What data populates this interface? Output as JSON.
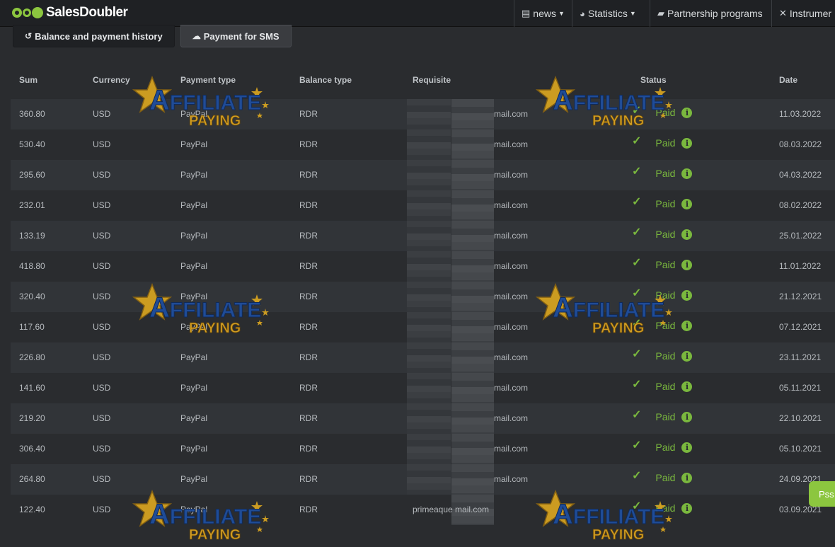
{
  "brand": {
    "name": "SalesDoubler"
  },
  "nav": [
    {
      "label": "news",
      "icon": "newspaper-icon",
      "dropdown": true
    },
    {
      "label": "Statistics",
      "icon": "pie-chart-icon",
      "dropdown": true
    },
    {
      "label": "Partnership programs",
      "icon": "briefcase-icon",
      "dropdown": false
    },
    {
      "label": "Instrumer",
      "icon": "tools-icon",
      "dropdown": false
    }
  ],
  "tabs": [
    {
      "label": "Balance and payment history",
      "icon": "history-icon",
      "active": true
    },
    {
      "label": "Payment for SMS",
      "icon": "chat-icon",
      "active": false
    }
  ],
  "table": {
    "headers": [
      "Sum",
      "Currency",
      "Payment type",
      "Balance type",
      "Requisite",
      "Status",
      "Date"
    ],
    "rows": [
      {
        "sum": "360.80",
        "currency": "USD",
        "payment_type": "PayPal",
        "balance_type": "RDR",
        "requisite": "mail.com",
        "status": "Paid",
        "date": "11.03.2022"
      },
      {
        "sum": "530.40",
        "currency": "USD",
        "payment_type": "PayPal",
        "balance_type": "RDR",
        "requisite": "mail.com",
        "status": "Paid",
        "date": "08.03.2022"
      },
      {
        "sum": "295.60",
        "currency": "USD",
        "payment_type": "PayPal",
        "balance_type": "RDR",
        "requisite": "mail.com",
        "status": "Paid",
        "date": "04.03.2022"
      },
      {
        "sum": "232.01",
        "currency": "USD",
        "payment_type": "PayPal",
        "balance_type": "RDR",
        "requisite": "mail.com",
        "status": "Paid",
        "date": "08.02.2022"
      },
      {
        "sum": "133.19",
        "currency": "USD",
        "payment_type": "PayPal",
        "balance_type": "RDR",
        "requisite": "mail.com",
        "status": "Paid",
        "date": "25.01.2022"
      },
      {
        "sum": "418.80",
        "currency": "USD",
        "payment_type": "PayPal",
        "balance_type": "RDR",
        "requisite": "mail.com",
        "status": "Paid",
        "date": "11.01.2022"
      },
      {
        "sum": "320.40",
        "currency": "USD",
        "payment_type": "PayPal",
        "balance_type": "RDR",
        "requisite": "mail.com",
        "status": "Paid",
        "date": "21.12.2021"
      },
      {
        "sum": "117.60",
        "currency": "USD",
        "payment_type": "PayPal",
        "balance_type": "RDR",
        "requisite": "mail.com",
        "status": "Paid",
        "date": "07.12.2021"
      },
      {
        "sum": "226.80",
        "currency": "USD",
        "payment_type": "PayPal",
        "balance_type": "RDR",
        "requisite": "mail.com",
        "status": "Paid",
        "date": "23.11.2021"
      },
      {
        "sum": "141.60",
        "currency": "USD",
        "payment_type": "PayPal",
        "balance_type": "RDR",
        "requisite": "mail.com",
        "status": "Paid",
        "date": "05.11.2021"
      },
      {
        "sum": "219.20",
        "currency": "USD",
        "payment_type": "PayPal",
        "balance_type": "RDR",
        "requisite": "mail.com",
        "status": "Paid",
        "date": "22.10.2021"
      },
      {
        "sum": "306.40",
        "currency": "USD",
        "payment_type": "PayPal",
        "balance_type": "RDR",
        "requisite": "mail.com",
        "status": "Paid",
        "date": "05.10.2021"
      },
      {
        "sum": "264.80",
        "currency": "USD",
        "payment_type": "PayPal",
        "balance_type": "RDR",
        "requisite": "mail.com",
        "status": "Paid",
        "date": "24.09.2021"
      },
      {
        "sum": "122.40",
        "currency": "USD",
        "payment_type": "PayPal",
        "balance_type": "RDR",
        "requisite": "primeaque mail.com",
        "status": "Paid",
        "date": "03.09.2021"
      }
    ]
  },
  "watermark": {
    "line1": "AFFILIATE",
    "line2": "PAYING"
  },
  "chat_button": {
    "label": "Pss"
  },
  "colors": {
    "accent": "#8cc63f",
    "paid": "#7ab83e",
    "background": "#2a2c2f"
  }
}
